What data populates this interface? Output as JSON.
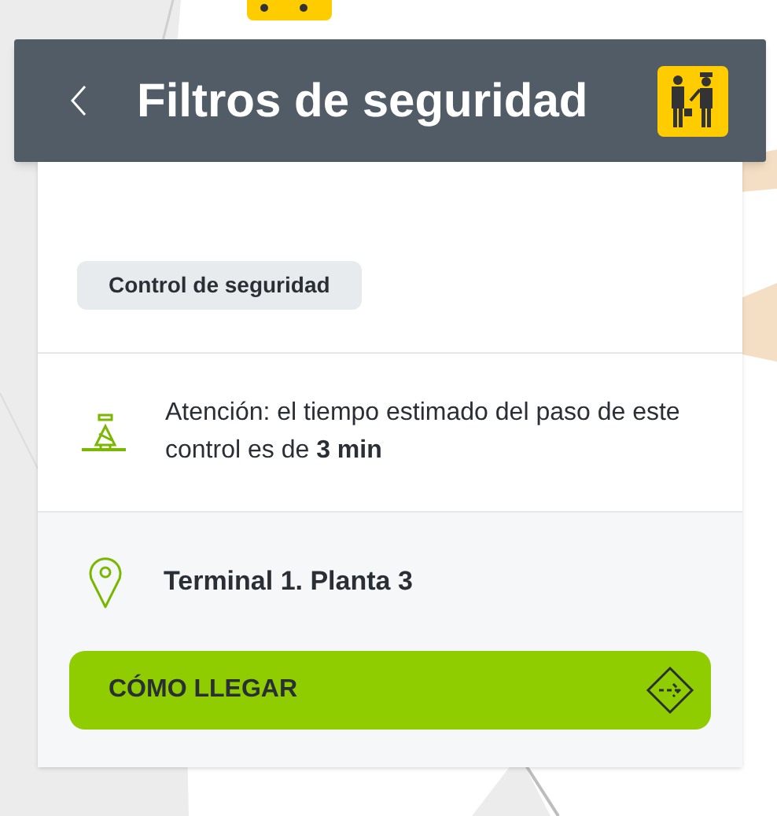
{
  "header": {
    "title": "Filtros de seguridad"
  },
  "tag": "Control de seguridad",
  "notice": "Atención: el tiempo estimado del paso de este control es de **3 min**",
  "location": "Terminal 1. Planta 3",
  "button": {
    "label": "CÓMO LLEGAR"
  }
}
